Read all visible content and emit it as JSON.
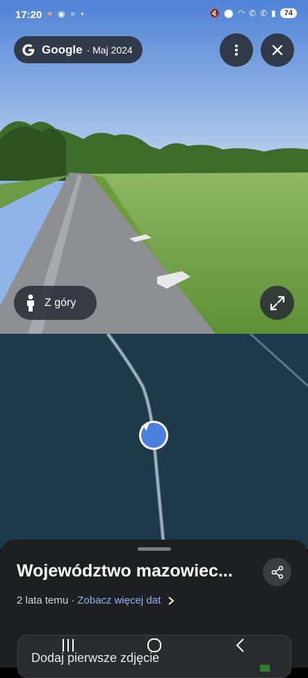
{
  "status_bar": {
    "time": "17:20",
    "battery": "74"
  },
  "streetview": {
    "brand": "Google",
    "date": "· Maj 2024",
    "menu_icon": "more-vertical-icon",
    "close_icon": "close-icon",
    "top_view_label": "Z góry",
    "expand_icon": "expand-icon"
  },
  "map": {
    "location_icon": "navigation-arrow-icon"
  },
  "sheet": {
    "title": "Województwo mazowiec...",
    "time_ago": "2 lata temu",
    "separator": "·",
    "more_dates_link": "Zobacz więcej dat",
    "add_photo_label": "Dodaj pierwsze zdjęcie"
  },
  "colors": {
    "accent": "#8ab4f8",
    "map_bg": "#1e3a4a",
    "location": "#4a7fe0"
  }
}
